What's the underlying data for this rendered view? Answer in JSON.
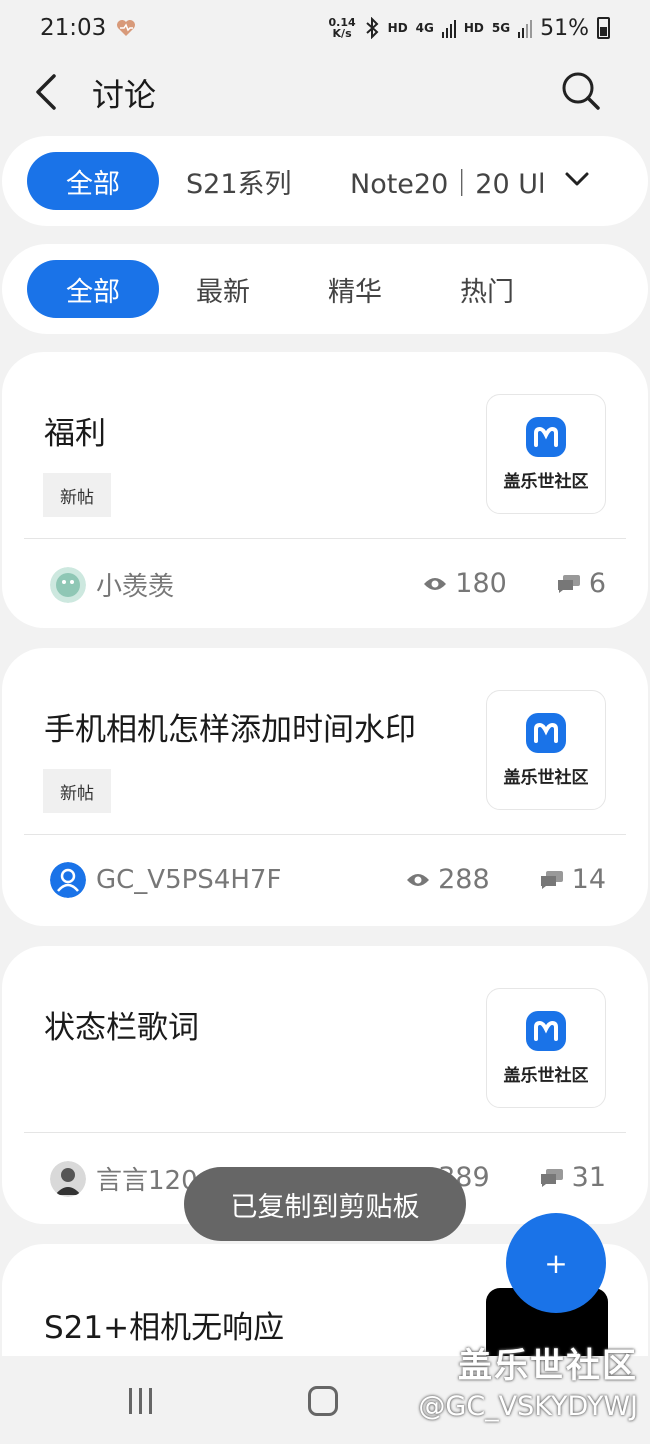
{
  "status_bar": {
    "time": "21:03",
    "net_speed_top": "0.14",
    "net_speed_bottom": "K/s",
    "hd1": "HD",
    "sig1": "4G",
    "hd2": "HD",
    "sig2": "5G",
    "battery": "51%"
  },
  "header": {
    "title": "讨论"
  },
  "series_tabs": [
    "全部",
    "S21系列",
    "Note20｜20 Ul"
  ],
  "filter_tabs": [
    "全部",
    "最新",
    "精华",
    "热门"
  ],
  "thumb_text": "盖乐世社区",
  "posts": [
    {
      "title": "福利",
      "tag": "新帖",
      "author": "小羡羡",
      "views": "180",
      "comments": "6"
    },
    {
      "title": "手机相机怎样添加时间水印",
      "tag": "新帖",
      "author": "GC_V5PS4H7F",
      "views": "288",
      "comments": "14"
    },
    {
      "title": "状态栏歌词",
      "tag": "",
      "author": "言言120",
      "views": "389",
      "comments": "31"
    },
    {
      "title": "S21+相机无响应"
    }
  ],
  "toast": "已复制到剪贴板",
  "fab_label": "+",
  "watermark": {
    "line1": "盖乐世社区",
    "line2": "@GC_VSKYDYWJ"
  },
  "colors": {
    "accent": "#1a73e8",
    "background": "#f2f2f2"
  }
}
